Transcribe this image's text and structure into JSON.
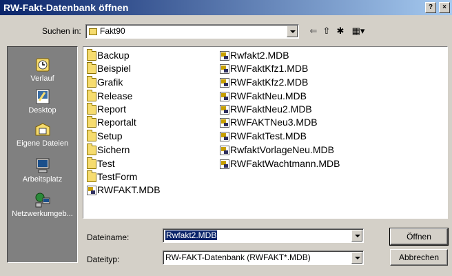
{
  "window": {
    "title": "RW-Fakt-Datenbank öffnen",
    "help_glyph": "?",
    "close_glyph": "×"
  },
  "lookin": {
    "label": "Suchen in:",
    "value": "Fakt90"
  },
  "toolbar": {
    "back_glyph": "⇐",
    "up_glyph": "⇧",
    "new_folder_glyph": "✱",
    "views_glyph": "▦▾"
  },
  "places": [
    {
      "label": "Verlauf",
      "icon": "history-icon"
    },
    {
      "label": "Desktop",
      "icon": "desktop-icon"
    },
    {
      "label": "Eigene Dateien",
      "icon": "my-documents-icon"
    },
    {
      "label": "Arbeitsplatz",
      "icon": "my-computer-icon"
    },
    {
      "label": "Netzwerkumgeb...",
      "icon": "network-icon"
    }
  ],
  "files_col1": [
    {
      "name": "Backup",
      "kind": "folder"
    },
    {
      "name": "Beispiel",
      "kind": "folder"
    },
    {
      "name": "Grafik",
      "kind": "folder"
    },
    {
      "name": "Release",
      "kind": "folder"
    },
    {
      "name": "Report",
      "kind": "folder"
    },
    {
      "name": "Reportalt",
      "kind": "folder"
    },
    {
      "name": "Setup",
      "kind": "folder"
    },
    {
      "name": "Sichern",
      "kind": "folder"
    },
    {
      "name": "Test",
      "kind": "folder"
    },
    {
      "name": "TestForm",
      "kind": "folder"
    },
    {
      "name": "RWFAKT.MDB",
      "kind": "mdb"
    }
  ],
  "files_col2": [
    {
      "name": "Rwfakt2.MDB",
      "kind": "mdb"
    },
    {
      "name": "RWFaktKfz1.MDB",
      "kind": "mdb"
    },
    {
      "name": "RWFaktKfz2.MDB",
      "kind": "mdb"
    },
    {
      "name": "RWFaktNeu.MDB",
      "kind": "mdb"
    },
    {
      "name": "RWFaktNeu2.MDB",
      "kind": "mdb"
    },
    {
      "name": "RWFAKTNeu3.MDB",
      "kind": "mdb"
    },
    {
      "name": "RWFaktTest.MDB",
      "kind": "mdb"
    },
    {
      "name": "RwfaktVorlageNeu.MDB",
      "kind": "mdb"
    },
    {
      "name": "RWFaktWachtmann.MDB",
      "kind": "mdb"
    }
  ],
  "filename": {
    "label": "Dateiname:",
    "value": "Rwfakt2.MDB"
  },
  "filetype": {
    "label": "Dateityp:",
    "value": "RW-FAKT-Datenbank (RWFAKT*.MDB)"
  },
  "buttons": {
    "open": "Öffnen",
    "cancel": "Abbrechen"
  }
}
